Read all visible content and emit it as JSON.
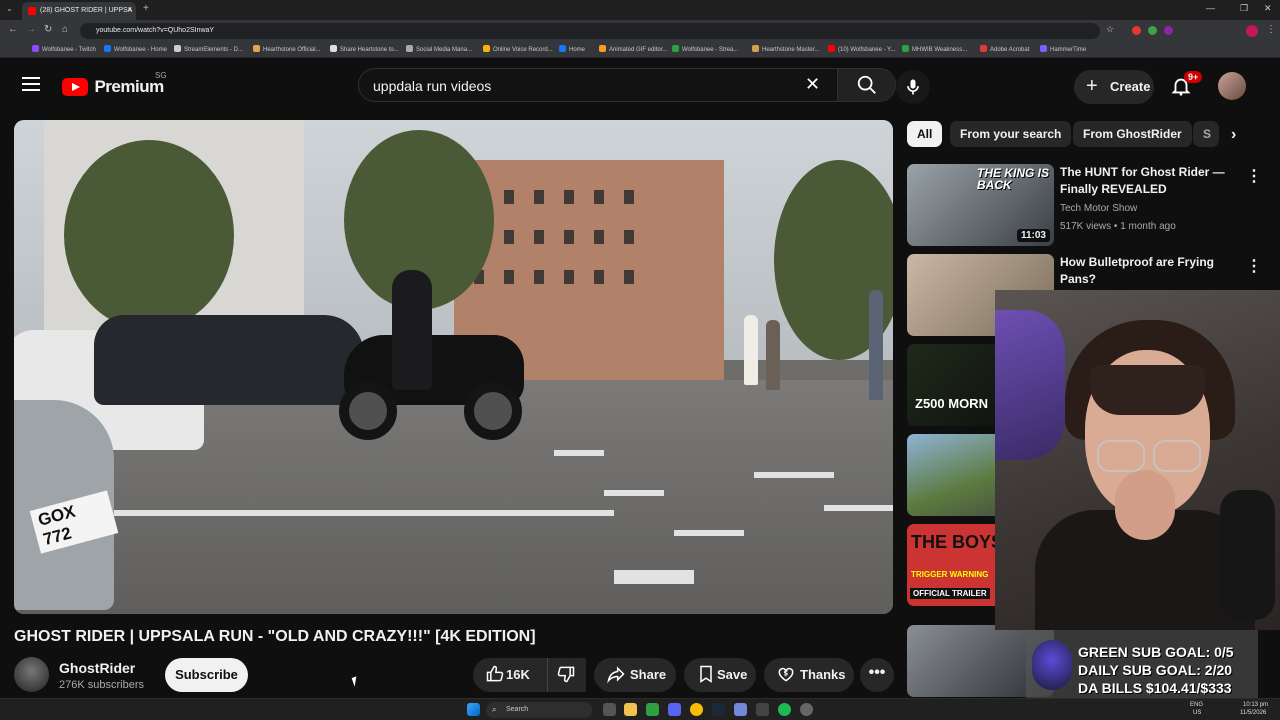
{
  "browser": {
    "tab_title": "(28) GHOST RIDER | UPPSA",
    "url": "youtube.com/watch?v=QUho2SInwaY",
    "bookmarks": [
      "Wolfsbanee - Twitch",
      "Wolfsbanee - Home",
      "StreamElements - D...",
      "Hearthstone Official...",
      "Share Heartstone to...",
      "Social Media Mana...",
      "Online Voice Record...",
      "Home",
      "Animated GIF editor...",
      "Wolfsbanee - Strea...",
      "Hearthstone Master...",
      "(10) Wolfsbanee - Y...",
      "MHWIB Weakness...",
      "Adobe Acrobat",
      "HammerTime"
    ]
  },
  "header": {
    "logo_text": "Premium",
    "region": "SG",
    "search_query": "uppdala run videos",
    "create_label": "Create",
    "notifications": "9+"
  },
  "video": {
    "title": "GHOST RIDER | UPPSALA RUN - \"OLD AND CRAZY!!!\" [4K EDITION]",
    "channel": "GhostRider",
    "subscribers": "276K subscribers",
    "subscribe_label": "Subscribe",
    "likes": "16K",
    "share_label": "Share",
    "save_label": "Save",
    "thanks_label": "Thanks",
    "plate": "GOX 772"
  },
  "filters": [
    "All",
    "From your search",
    "From GhostRider",
    "S"
  ],
  "recommendations": [
    {
      "title": "The HUNT for Ghost Rider — Finally REVEALED",
      "channel": "Tech Motor Show",
      "meta": "517K views • 1 month ago",
      "duration": "11:03",
      "thumb_text": "THE KING IS BACK"
    },
    {
      "title": "How Bulletproof are Frying Pans?",
      "channel": "",
      "meta": "",
      "duration": "",
      "thumb_text": ""
    },
    {
      "thumb_text": "Z500 MORN"
    },
    {
      "thumb_text": ""
    },
    {
      "thumb_text": "THE BOYS",
      "thumb_sub": "OFFICIAL TRAILER",
      "thumb_tag": "TRIGGER WARNING"
    }
  ],
  "overlay": {
    "line1": "GREEN SUB GOAL: 0/5",
    "line2": "DAILY SUB GOAL: 2/20",
    "line3": "DA BILLS $104.41/$333"
  },
  "taskbar": {
    "search_label": "Search",
    "lang": "ENG",
    "region": "US",
    "time": "10:13 pm",
    "date": "11/5/2026"
  },
  "colors": {
    "background": "#0f0f0f",
    "accent_red": "#ff0000",
    "chip_bg": "#272727"
  }
}
